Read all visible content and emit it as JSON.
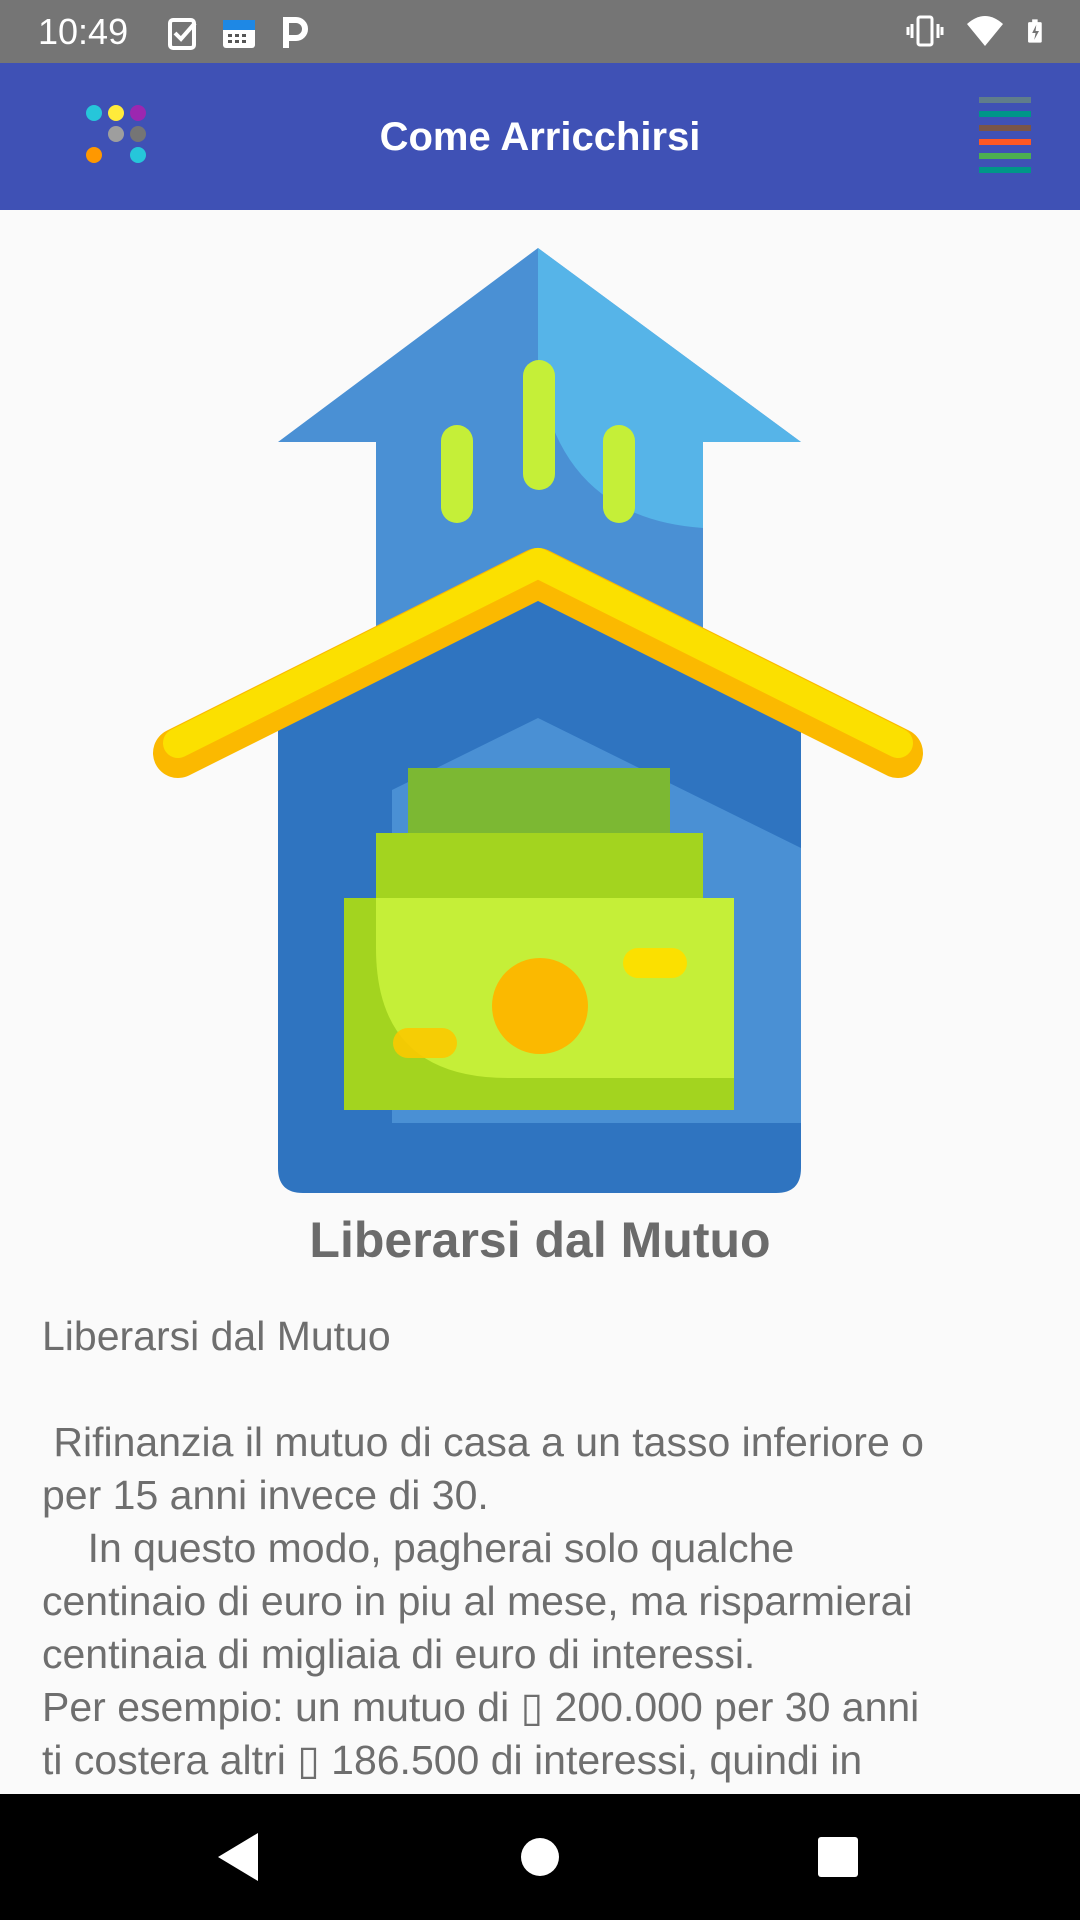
{
  "status_bar": {
    "time": "10:49",
    "left_icons": [
      "task-check-icon",
      "test-calendar-icon",
      "parking-p-icon"
    ],
    "right_icons": [
      "vibrate-icon",
      "wifi-icon",
      "battery-charging-icon"
    ]
  },
  "app_bar": {
    "title": "Come Arricchirsi",
    "color": "#3f51b5",
    "logo_icon": "dots-logo-icon",
    "menu_icon": "colored-lines-menu-icon"
  },
  "article": {
    "image_icon": "house-with-money-icon",
    "title": "Liberarsi dal Mutuo",
    "heading": "Liberarsi dal Mutuo",
    "lines": [
      " Rifinanzia il mutuo di casa a un tasso inferiore o",
      "per 15 anni invece di 30.",
      "    In questo modo, pagherai solo qualche",
      "centinaio di euro in piu al mese, ma risparmierai",
      "centinaia di migliaia di euro di interessi.",
      "Per esempio: un mutuo di ▯ 200.000 per 30 anni",
      "ti costera altri ▯ 186.500 di interessi, quindi in"
    ]
  },
  "nav_bar": {
    "buttons": [
      "back-icon",
      "home-icon",
      "recents-icon"
    ]
  }
}
